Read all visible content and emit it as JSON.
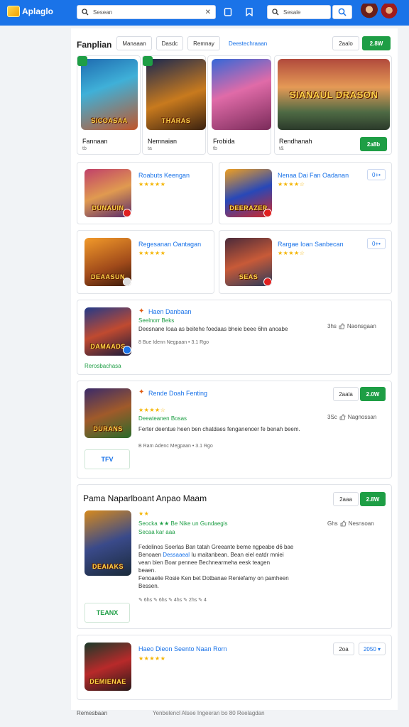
{
  "app": {
    "logo_text": "Aplaglo"
  },
  "header": {
    "search_placeholder": "Sesean",
    "search2_placeholder": "Sesale",
    "icons": [
      "search-icon",
      "clear-icon",
      "tablet-icon",
      "bookmark-icon",
      "magnify-icon"
    ]
  },
  "section": {
    "title": "Fanplian",
    "filters": [
      "Manaaan",
      "Dasdc",
      "Remnay"
    ],
    "link": "Deestechraaan",
    "btn_outline": "2aalo",
    "btn_green": "2.8W"
  },
  "featured": [
    {
      "art": "SICOASAA",
      "name": "Fannaan",
      "sub": "tb"
    },
    {
      "art": "THARAS",
      "name": "Nemnaian",
      "sub": "ta"
    },
    {
      "art": "",
      "name": "Frobida",
      "sub": "tb"
    },
    {
      "art": "SIANAUL DRASON",
      "name": "Rendhanah",
      "sub": "t&",
      "button": "2a8b"
    }
  ],
  "grid": [
    {
      "art": "DUNAUIN",
      "title": "Roabuts Keengan",
      "stars": "★★★★★"
    },
    {
      "art": "DEERAZER",
      "title": "Nenaa Dai Fan Oadanan",
      "stars": "★★★★☆",
      "more": "0+•"
    },
    {
      "art": "DEAASUN",
      "title": "Regesanan Oantagan",
      "stars": "★★★★★"
    },
    {
      "art": "SEAS",
      "title": "Rargae Ioan Sanbecan",
      "stars": "★★★★☆",
      "more": "0+•"
    }
  ],
  "list": [
    {
      "art": "DAMAADS",
      "title": "Haen Danbaan",
      "green": "Seelnorr Beks",
      "desc": "Deesnane Ioaa as beitehe foedaas bheie beee 6hn anoabe",
      "meta": "8 Bue Idenn Negpaan • 3.1 Rgo",
      "side": "Naonsgaan",
      "side_num": "3hs",
      "tag": "Rerosbachasa"
    },
    {
      "art": "DURANS",
      "title": "Rende Doah Fenting",
      "stars": "★★★★☆",
      "green": "Deeateanen Bosas",
      "desc": "Ferter deentue heen ben chatdaes fenganenoer fe benah beem.",
      "meta": "B Ram Adenc Megpaan • 3.1 Rgo",
      "side": "Nagnossan",
      "side_num": "3Sc",
      "btn_outline": "2aala",
      "btn_green": "2.0W",
      "tag": "TFV"
    },
    {
      "heading": "Pama Naparlboant Anpao Maam",
      "art": "DEAIAKS",
      "stars_small": "★★",
      "green": "Seocka ★★ Be Nike un Gundaegis",
      "green2": "Secaa kar aaa",
      "desc_parts": [
        "Fedelinos Soerlas Ban tatah Greeante beme ngpeabe d6 bae",
        "Benoaen ",
        "Dessaaeal",
        " Iu maitanbean. Bean eiel eatdr mniei",
        "vean bien Boar pennee Bechnearmeha eesk teagen",
        "beaen.",
        "Fenoaelie Rosie Ken bet Dotbanae Reniefamy on pamheen",
        "Bessen."
      ],
      "meta": "✎ 6hs ✎ 6hs ✎ 4hs ✎ 2hs ✎ 4",
      "side": "Nesnsoan",
      "side_num": "Ghs",
      "btn_outline": "2aaa",
      "btn_green": "2.8W",
      "tag": "TEANX"
    },
    {
      "art": "DEMIENAE",
      "title": "Haeo Dieon Seento Naan Rorn",
      "stars": "★★★★★",
      "btn_outline": "2oa",
      "more": "2050 ▾"
    }
  ],
  "footer": {
    "left": "Remesbaan",
    "right": "Yenbelencl Alsee Ingeeran bo 80 Reelagdan"
  },
  "colors": {
    "header": "#1a73e8",
    "green": "#1e9e45",
    "link": "#1a73e8",
    "star": "#f4b400"
  }
}
